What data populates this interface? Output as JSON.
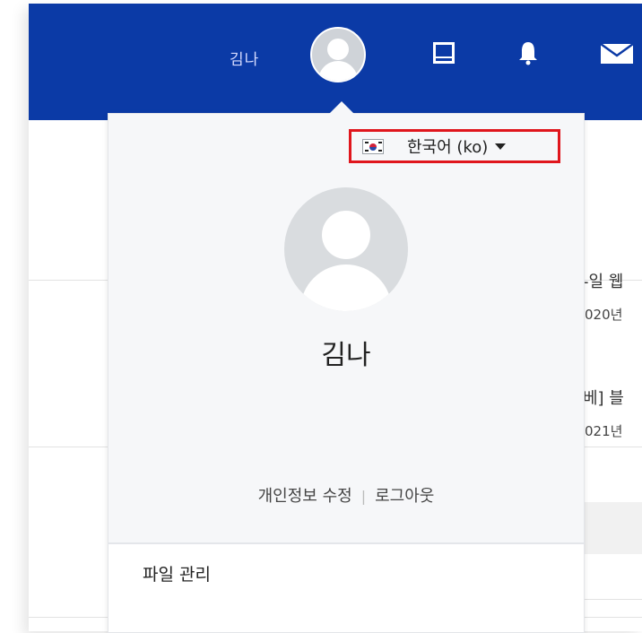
{
  "topbar": {
    "user_name": "김나",
    "icons": [
      "avatar-icon",
      "book-icon",
      "bell-icon",
      "envelope-icon"
    ],
    "background_color": "#0b3aa6"
  },
  "background": {
    "snippet1_title": "-일 웹",
    "snippet1_date": "020년",
    "snippet2_title": "베] 블",
    "snippet2_date": "021년"
  },
  "popup": {
    "language": {
      "label": "한국어 (ko)",
      "flag": "korea-flag-icon",
      "highlight_color": "#e0161d"
    },
    "user_name": "김나",
    "edit_profile": "개인정보 수정",
    "separator": "|",
    "logout": "로그아웃",
    "menu_item": "파일 관리"
  }
}
